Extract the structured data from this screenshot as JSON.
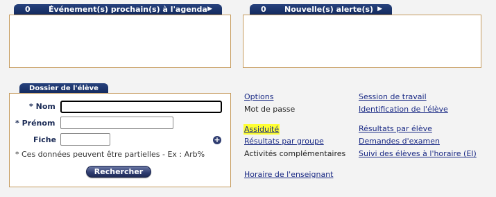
{
  "agenda": {
    "count": "0",
    "title": "Événement(s) prochain(s) à l'agenda",
    "arrow": "▶"
  },
  "alerts": {
    "count": "0",
    "title": "Nouvelle(s) alerte(s)",
    "arrow": "▶"
  },
  "dossier": {
    "tab_title": "Dossier de l'élève",
    "nom_star": "*",
    "nom_label": "Nom",
    "nom_value": "",
    "prenom_star": "*",
    "prenom_label": "Prénom",
    "prenom_value": "",
    "fiche_label": "Fiche",
    "fiche_value": "",
    "plus_glyph": "+",
    "hint": "* Ces données peuvent être partielles - Ex : Arb%",
    "search_button": "Rechercher"
  },
  "menu_left": [
    {
      "label": "Options",
      "type": "link"
    },
    {
      "label": "Mot de passe",
      "type": "text"
    },
    {
      "label": "Assiduité",
      "type": "link",
      "highlighted": true
    },
    {
      "label": "Résultats par groupe",
      "type": "link"
    },
    {
      "label": "Activités complémentaires",
      "type": "text"
    },
    {
      "label": "Horaire de l'enseignant",
      "type": "link"
    }
  ],
  "menu_right": [
    {
      "label": "Session de travail",
      "type": "link"
    },
    {
      "label": "Identification de l'élève",
      "type": "link"
    },
    {
      "label": "Résultats par élève",
      "type": "link"
    },
    {
      "label": "Demandes d'examen",
      "type": "link"
    },
    {
      "label": "Suivi des élèves à l'horaire (EI)",
      "type": "link"
    }
  ],
  "colors": {
    "tab": "#1b3066",
    "panel_border": "#c59a5c",
    "link": "#1a2a85",
    "highlight": "#ffff33"
  }
}
